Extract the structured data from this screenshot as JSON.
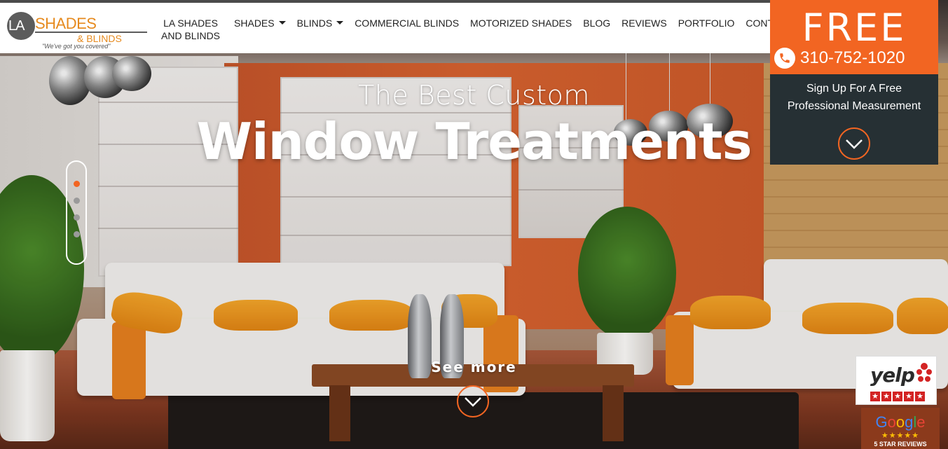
{
  "brand": {
    "logo_la": "LA",
    "logo_shades": "SHADES",
    "logo_blinds": "& BLINDS",
    "logo_tagline": "\"We've got you covered\""
  },
  "nav": {
    "items": [
      {
        "label_line1": "LA SHADES",
        "label_line2": "AND BLINDS",
        "has_caret": false
      },
      {
        "label": "SHADES",
        "has_caret": true
      },
      {
        "label": "BLINDS",
        "has_caret": true
      },
      {
        "label": "COMMERCIAL BLINDS",
        "has_caret": false
      },
      {
        "label": "MOTORIZED SHADES",
        "has_caret": false
      },
      {
        "label": "BLOG",
        "has_caret": false
      },
      {
        "label": "REVIEWS",
        "has_caret": false
      },
      {
        "label": "PORTFOLIO",
        "has_caret": false
      },
      {
        "label": "CONTACT",
        "has_caret": false
      }
    ]
  },
  "cta": {
    "free_label": "FREE",
    "phone": "310-752-1020",
    "signup_line1": "Sign Up For A Free",
    "signup_line2": "Professional Measurement"
  },
  "hero": {
    "subtitle": "The Best Custom",
    "title": "Window Treatments",
    "see_more": "See more",
    "slide_count": 4,
    "active_slide": 1
  },
  "badges": {
    "yelp_word": "yelp",
    "google_word": "Google",
    "google_stars": "★★★★★",
    "google_caption": "5 STAR REVIEWS"
  },
  "colors": {
    "accent": "#f26522",
    "dark_panel": "#263034",
    "logo_orange": "#e68a1e",
    "yelp_red": "#d32323"
  },
  "icons": {
    "phone": "phone-icon",
    "chevron": "chevron-down-icon",
    "caret": "caret-down-icon"
  }
}
